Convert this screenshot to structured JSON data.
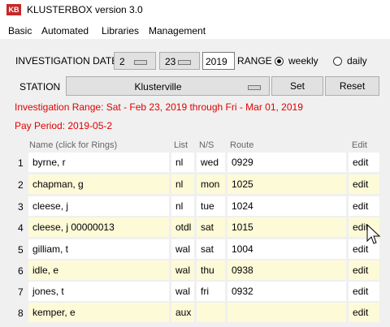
{
  "window": {
    "icon_text": "KB",
    "title": "KLUSTERBOX version 3.0"
  },
  "menu": [
    "Basic",
    "Automated",
    "Libraries",
    "Management"
  ],
  "investigation": {
    "label": "INVESTIGATION DATE",
    "month": "2",
    "day": "23",
    "year": "2019",
    "range_label": "RANGE",
    "weekly_label": "weekly",
    "daily_label": "daily",
    "selected_range": "weekly"
  },
  "station": {
    "label": "STATION",
    "value": "Klusterville",
    "set_label": "Set",
    "reset_label": "Reset"
  },
  "info": {
    "range_text": "Investigation Range: Sat - Feb 23, 2019 through Fri - Mar 01, 2019",
    "pay_period_text": "Pay Period: 2019-05-2",
    "color": "#e00000"
  },
  "table": {
    "headers": {
      "name": "Name (click for Rings)",
      "list": "List",
      "ns": "N/S",
      "route": "Route",
      "edit": "Edit"
    },
    "rows": [
      {
        "num": "1",
        "name": "byrne, r",
        "list": "nl",
        "ns": "wed",
        "route": "0929",
        "edit": "edit"
      },
      {
        "num": "2",
        "name": "chapman, g",
        "list": "nl",
        "ns": "mon",
        "route": "1025",
        "edit": "edit"
      },
      {
        "num": "3",
        "name": "cleese, j",
        "list": "nl",
        "ns": "tue",
        "route": "1024",
        "edit": "edit"
      },
      {
        "num": "4",
        "name": "cleese, j 00000013",
        "list": "otdl",
        "ns": "sat",
        "route": "1015",
        "edit": "edit"
      },
      {
        "num": "5",
        "name": "gilliam, t",
        "list": "wal",
        "ns": "sat",
        "route": "1004",
        "edit": "edit"
      },
      {
        "num": "6",
        "name": "idle, e",
        "list": "wal",
        "ns": "thu",
        "route": "0938",
        "edit": "edit"
      },
      {
        "num": "7",
        "name": "jones, t",
        "list": "wal",
        "ns": "fri",
        "route": "0932",
        "edit": "edit"
      },
      {
        "num": "8",
        "name": "kemper, e",
        "list": "aux",
        "ns": "",
        "route": "",
        "edit": "edit"
      }
    ]
  }
}
